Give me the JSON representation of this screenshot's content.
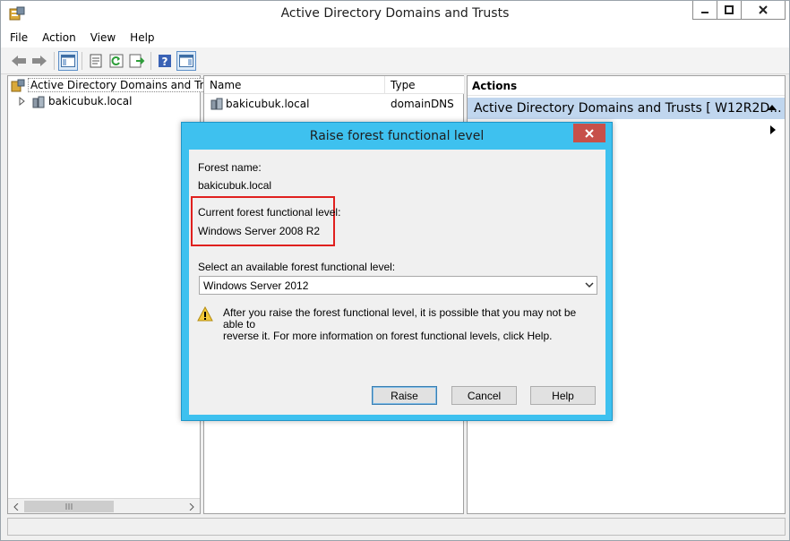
{
  "window": {
    "title": "Active Directory Domains and Trusts"
  },
  "menu": {
    "items": [
      "File",
      "Action",
      "View",
      "Help"
    ]
  },
  "toolbar": {
    "icons": [
      "back-arrow-icon",
      "forward-arrow-icon",
      "console-tree-icon",
      "properties-icon",
      "refresh-icon",
      "export-list-icon",
      "help-icon",
      "show-hide-action-pane-icon"
    ]
  },
  "tree": {
    "root_label": "Active Directory Domains and Trust",
    "child_label": "bakicubuk.local"
  },
  "list": {
    "columns": [
      "Name",
      "Type"
    ],
    "rows": [
      {
        "name": "bakicubuk.local",
        "type": "domainDNS"
      }
    ]
  },
  "actions": {
    "header": "Actions",
    "selected": "Active Directory Domains and Trusts [ W12R2D..."
  },
  "dialog": {
    "title": "Raise forest functional level",
    "forest_name_label": "Forest name:",
    "forest_name_value": "bakicubuk.local",
    "current_level_label": "Current forest functional level:",
    "current_level_value": "Windows Server 2008 R2",
    "select_label": "Select an available forest functional level:",
    "select_value": "Windows Server 2012",
    "warning_line1": "After you raise the forest functional level, it is possible that you may not be able to",
    "warning_line2": "reverse it. For more information on forest functional levels, click Help.",
    "buttons": {
      "raise": "Raise",
      "cancel": "Cancel",
      "help": "Help"
    }
  },
  "colors": {
    "dialog_frame": "#3ec1ef",
    "close_button": "#c7504a",
    "highlight_box": "#e0201e",
    "selection": "#c0d6ee"
  }
}
